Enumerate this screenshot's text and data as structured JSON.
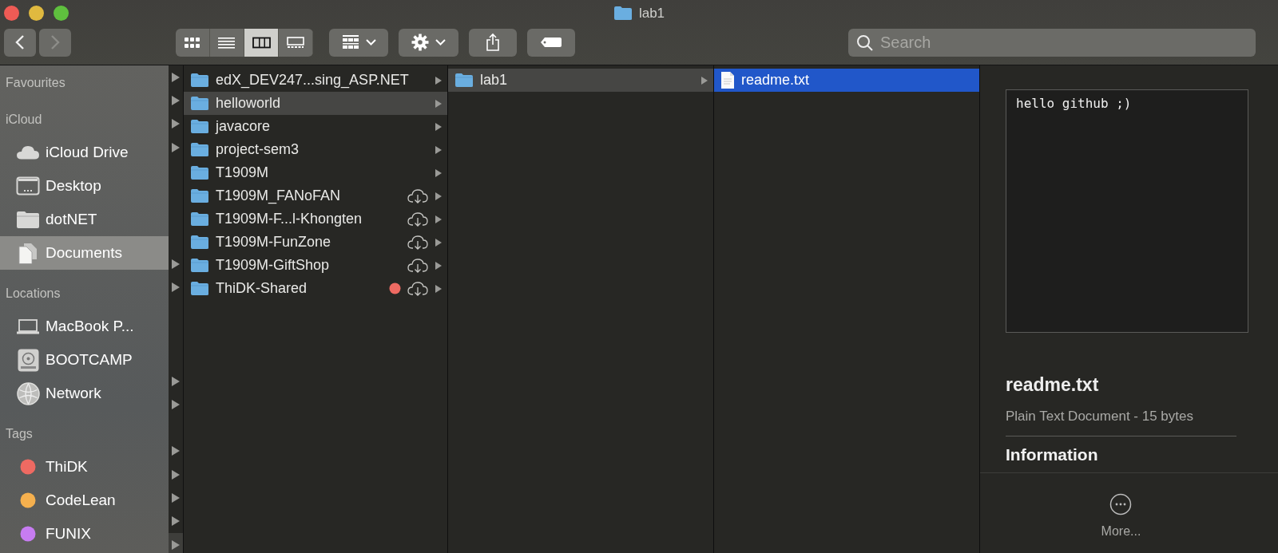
{
  "window": {
    "title": "lab1"
  },
  "navigation": [
    {
      "kind": "back",
      "disabled": false
    },
    {
      "kind": "forward",
      "disabled": true
    }
  ],
  "view_modes": [
    {
      "kind": "icons",
      "selected": false
    },
    {
      "kind": "list",
      "selected": false
    },
    {
      "kind": "columns",
      "selected": true
    },
    {
      "kind": "gallery",
      "selected": false
    }
  ],
  "toolbar_buttons": [
    {
      "kind": "group",
      "menu": true
    },
    {
      "kind": "action",
      "menu": true
    },
    {
      "kind": "share",
      "menu": false
    },
    {
      "kind": "tag",
      "menu": false
    }
  ],
  "search": {
    "placeholder": "Search"
  },
  "sidebar": [
    {
      "kind": "header",
      "label": "Favourites"
    },
    {
      "kind": "header",
      "label": "iCloud"
    },
    {
      "kind": "cloud",
      "label": "iCloud Drive",
      "selected": false
    },
    {
      "kind": "desktop",
      "label": "Desktop",
      "selected": false
    },
    {
      "kind": "folder",
      "label": "dotNET",
      "selected": false
    },
    {
      "kind": "documents",
      "label": "Documents",
      "selected": true
    },
    {
      "kind": "header",
      "label": "Locations"
    },
    {
      "kind": "laptop",
      "label": "MacBook P...",
      "selected": false
    },
    {
      "kind": "disk",
      "label": "BOOTCAMP",
      "selected": false
    },
    {
      "kind": "network",
      "label": "Network",
      "selected": false
    },
    {
      "kind": "header",
      "label": "Tags"
    },
    {
      "kind": "tag",
      "label": "ThiDK",
      "color": "#ee6a62"
    },
    {
      "kind": "tag",
      "label": "CodeLean",
      "color": "#f5b04e"
    },
    {
      "kind": "tag",
      "label": "FUNIX",
      "color": "#c77cf2"
    }
  ],
  "previous_column": [
    {
      "kind": "folder",
      "selected": false
    },
    {
      "kind": "folder",
      "selected": false
    },
    {
      "kind": "folder",
      "selected": false
    },
    {
      "kind": "folder",
      "selected": false
    },
    {
      "kind": "file",
      "selected": false
    },
    {
      "kind": "file",
      "selected": false
    },
    {
      "kind": "file",
      "selected": false
    },
    {
      "kind": "file",
      "selected": false
    },
    {
      "kind": "folder",
      "selected": false
    },
    {
      "kind": "folder",
      "selected": false
    },
    {
      "kind": "file",
      "selected": false
    },
    {
      "kind": "file",
      "selected": false
    },
    {
      "kind": "file",
      "selected": false
    },
    {
      "kind": "folder",
      "selected": false
    },
    {
      "kind": "folder",
      "selected": false
    },
    {
      "kind": "file",
      "selected": false
    },
    {
      "kind": "folder",
      "selected": false
    },
    {
      "kind": "folder",
      "selected": false
    },
    {
      "kind": "folder",
      "selected": false
    },
    {
      "kind": "folder",
      "selected": false
    },
    {
      "kind": "folder",
      "selected": true
    }
  ],
  "columns": [
    {
      "items": [
        {
          "kind": "folder",
          "name": "edX_DEV247...sing_ASP.NET",
          "selected": false,
          "cloud": false
        },
        {
          "kind": "folder",
          "name": "helloworld",
          "selected": true,
          "cloud": false
        },
        {
          "kind": "folder",
          "name": "javacore",
          "selected": false,
          "cloud": false
        },
        {
          "kind": "folder",
          "name": "project-sem3",
          "selected": false,
          "cloud": false
        },
        {
          "kind": "folder",
          "name": "T1909M",
          "selected": false,
          "cloud": false
        },
        {
          "kind": "folder",
          "name": "T1909M_FANoFAN",
          "selected": false,
          "cloud": true
        },
        {
          "kind": "folder",
          "name": "T1909M-F...l-Khongten",
          "selected": false,
          "cloud": true
        },
        {
          "kind": "folder",
          "name": "T1909M-FunZone",
          "selected": false,
          "cloud": true
        },
        {
          "kind": "folder",
          "name": "T1909M-GiftShop",
          "selected": false,
          "cloud": true
        },
        {
          "kind": "folder",
          "name": "ThiDK-Shared",
          "selected": false,
          "cloud": true,
          "color": "#ee6a62"
        }
      ]
    },
    {
      "items": [
        {
          "kind": "folder",
          "name": "lab1",
          "selected": true,
          "cloud": false
        }
      ]
    },
    {
      "items": [
        {
          "kind": "file",
          "name": "readme.txt",
          "selected": true,
          "cloud": false
        }
      ]
    }
  ],
  "preview": {
    "content": "hello github ;)",
    "name": "readme.txt",
    "type": "Plain Text Document - 15 bytes",
    "section": "Information",
    "more": "More..."
  }
}
